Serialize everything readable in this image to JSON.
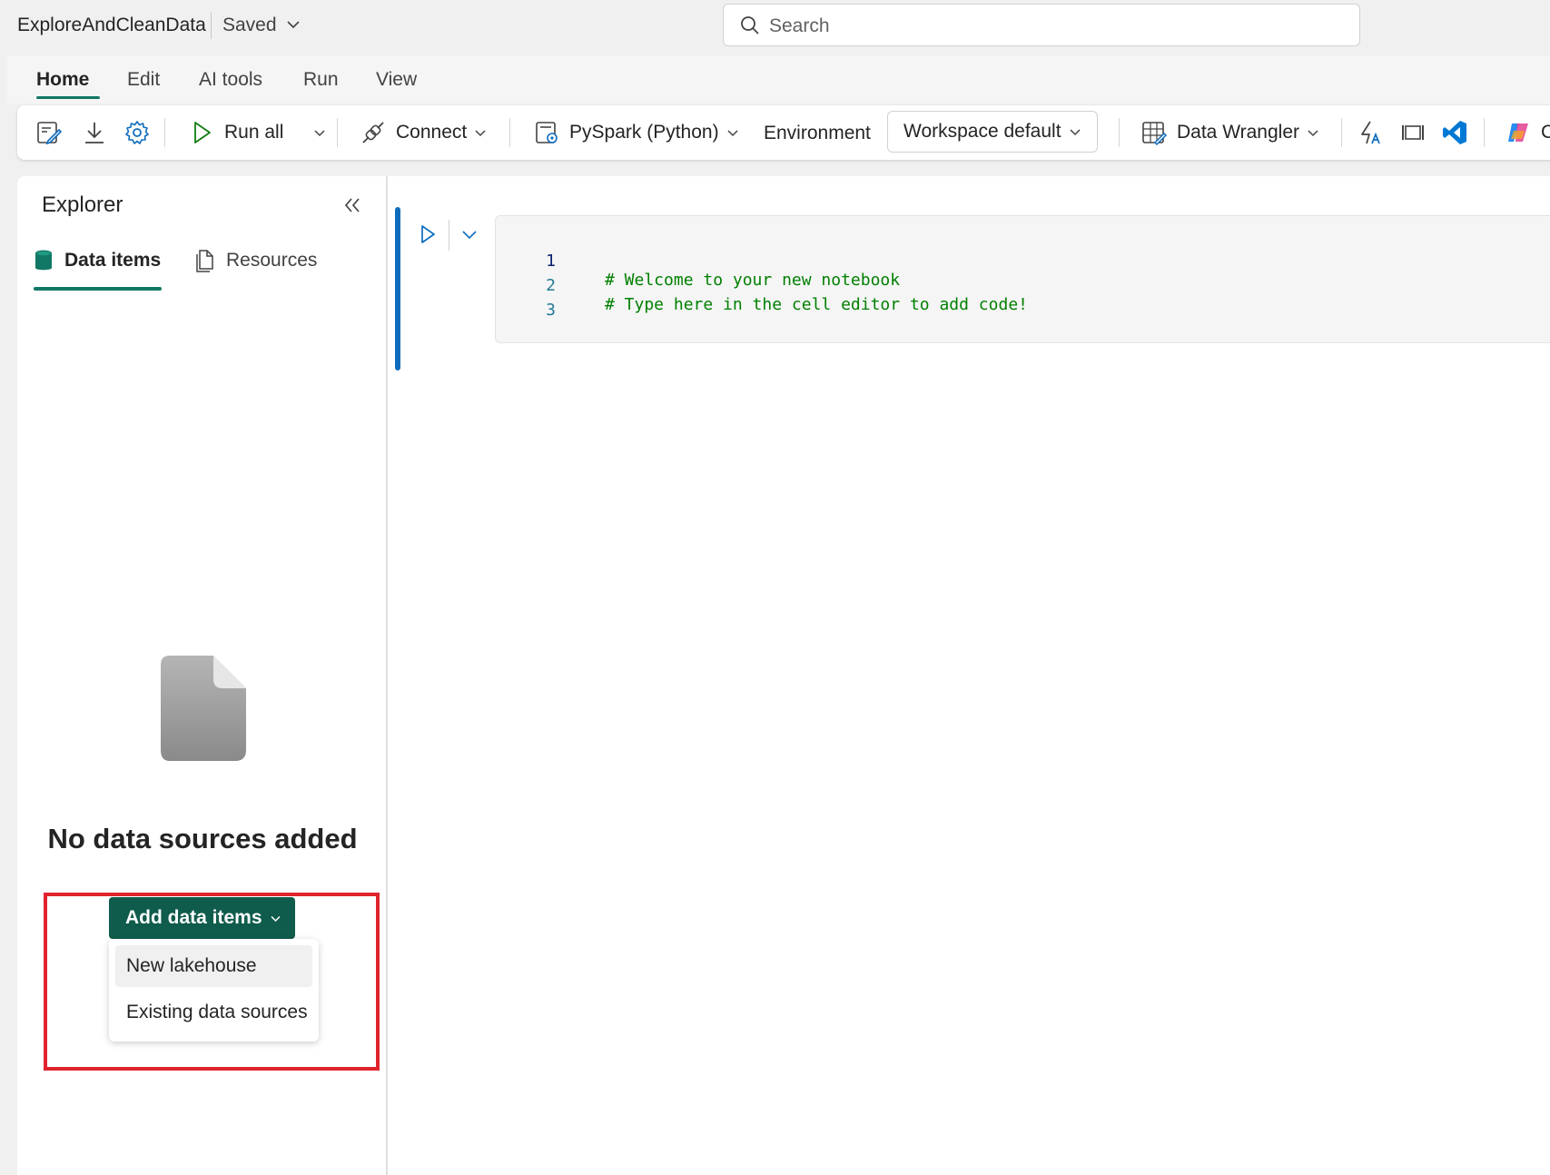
{
  "titlebar": {
    "notebook_name": "ExploreAndCleanData",
    "status": "Saved",
    "search_placeholder": "Search"
  },
  "tabs": [
    {
      "label": "Home",
      "active": true
    },
    {
      "label": "Edit"
    },
    {
      "label": "AI tools"
    },
    {
      "label": "Run"
    },
    {
      "label": "View"
    }
  ],
  "toolbar": {
    "run_all": "Run all",
    "connect": "Connect",
    "language": "PySpark (Python)",
    "environment_label": "Environment",
    "environment_value": "Workspace default",
    "data_wrangler": "Data Wrangler",
    "copilot_partial": "C"
  },
  "explorer": {
    "title": "Explorer",
    "tab_data_items": "Data items",
    "tab_resources": "Resources",
    "empty_title": "No data sources added",
    "add_button": "Add data items",
    "menu": [
      "New lakehouse",
      "Existing data sources"
    ]
  },
  "cell": {
    "lines": [
      {
        "num": "1",
        "code": "# Welcome to your new notebook"
      },
      {
        "num": "2",
        "code": "# Type here in the cell editor to add code!"
      },
      {
        "num": "3",
        "code": ""
      }
    ]
  },
  "colors": {
    "accent": "#117865",
    "primary_button": "#0f5c4c",
    "highlight": "#e0242c",
    "code_comment": "#008000",
    "cell_focus": "#0f6cbd"
  },
  "icons": [
    "edit-notebook-icon",
    "download-icon",
    "settings-icon",
    "play-icon",
    "chevron-down-icon",
    "connect-icon",
    "pyspark-icon",
    "data-wrangler-icon",
    "spark-advisor-icon",
    "full-screen-icon",
    "vscode-icon",
    "copilot-icon",
    "search-icon",
    "collapse-double-chevron-icon",
    "database-icon",
    "document-icon"
  ]
}
